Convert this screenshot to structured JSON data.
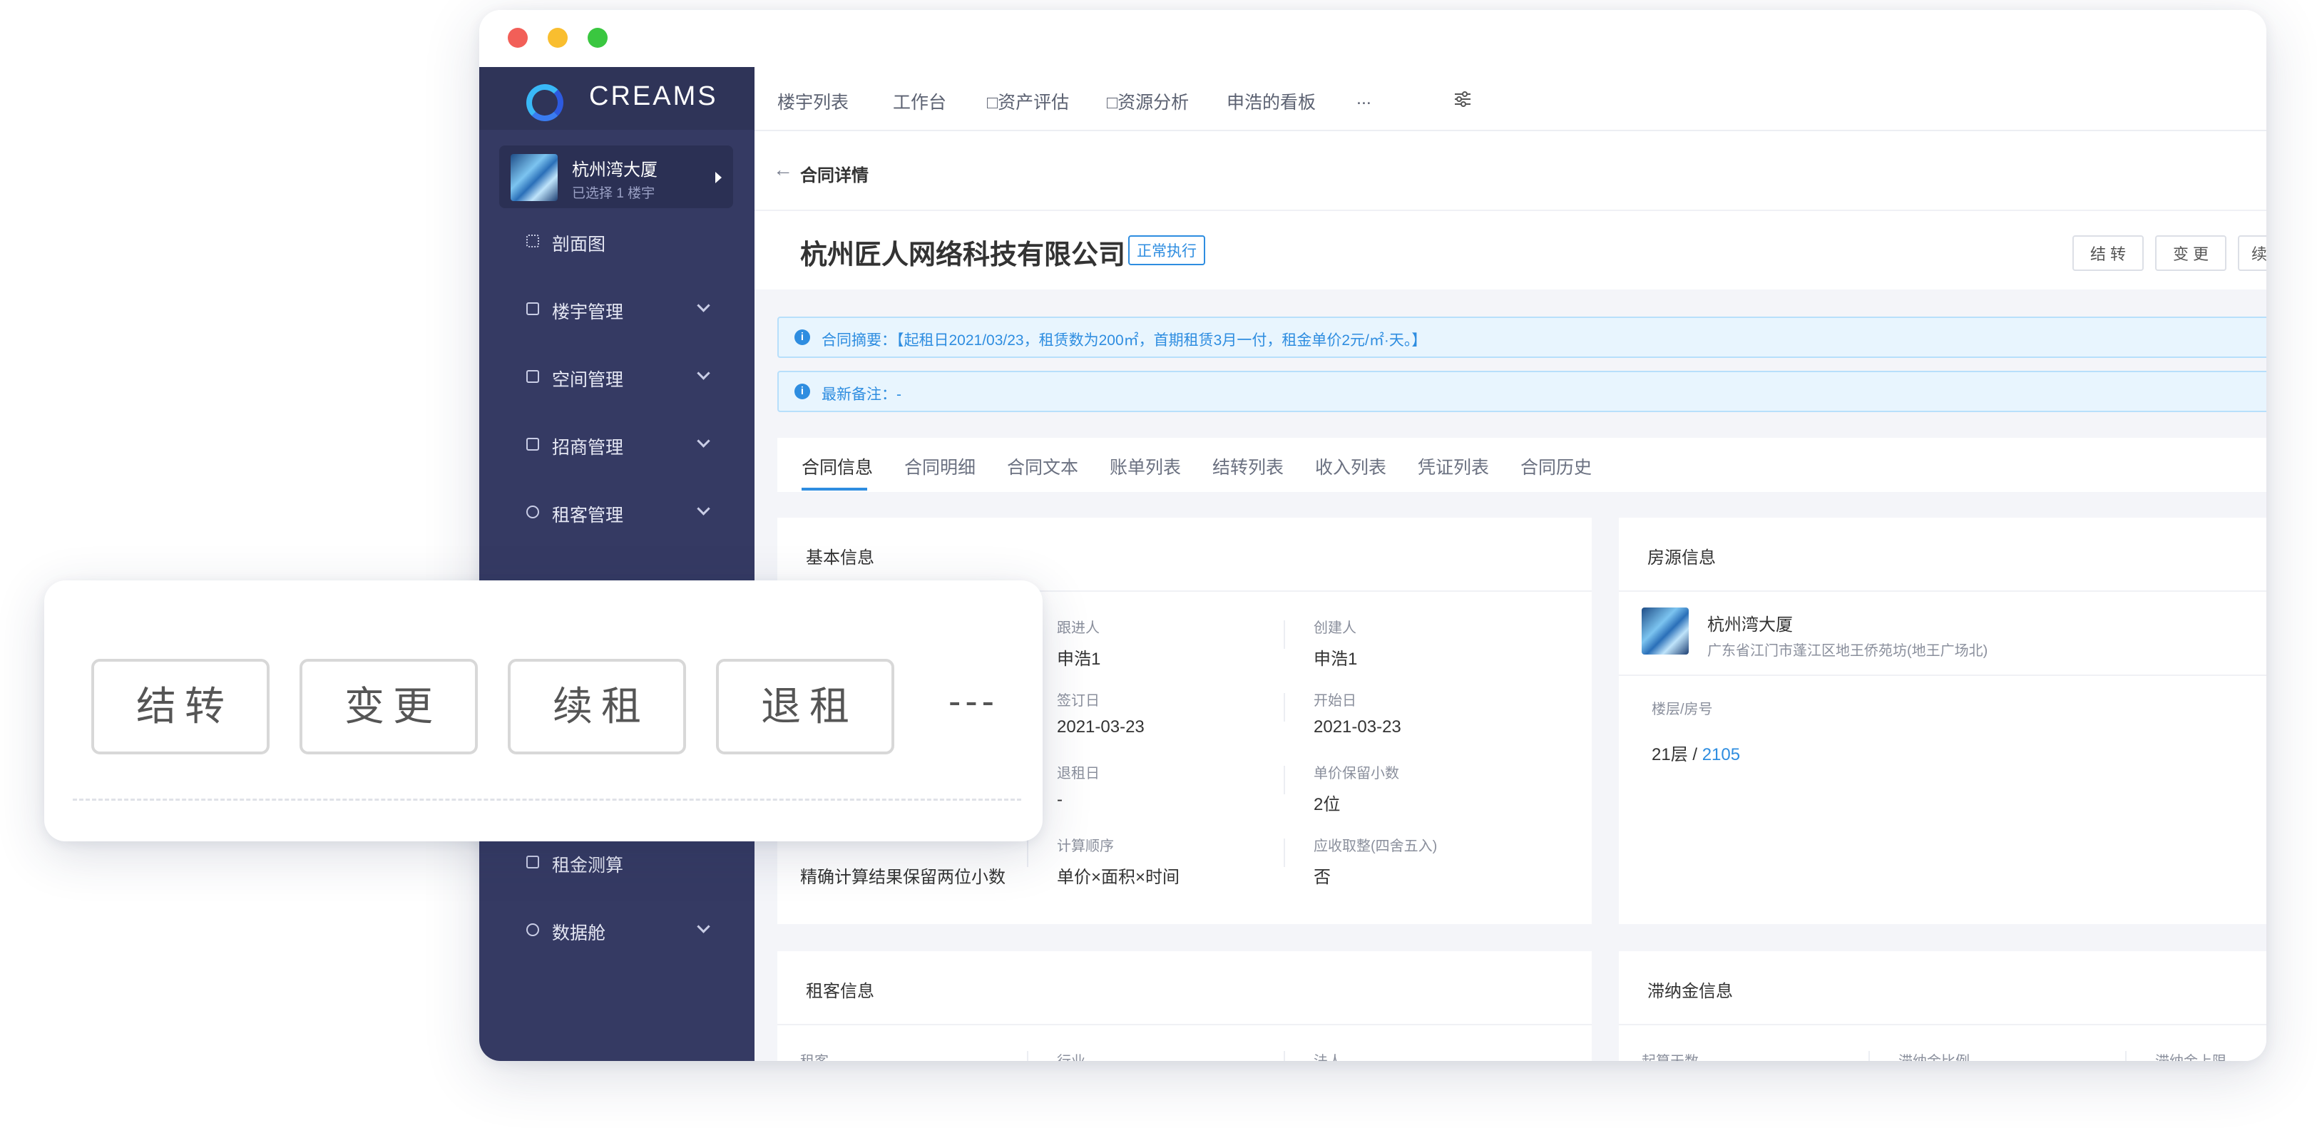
{
  "window": {
    "brand": "CREAMS",
    "project": {
      "name": "杭州湾大厦",
      "sub": "已选择 1 楼宇"
    },
    "sidebar": {
      "items": [
        {
          "label": "剖面图",
          "icon": "grid-icon",
          "chevron": false
        },
        {
          "label": "楼宇管理",
          "icon": "building-icon",
          "chevron": true
        },
        {
          "label": "空间管理",
          "icon": "layout-icon",
          "chevron": true
        },
        {
          "label": "招商管理",
          "icon": "enter-icon",
          "chevron": true
        },
        {
          "label": "租客管理",
          "icon": "user-icon",
          "chevron": true
        },
        {
          "label": "租金测算",
          "icon": "calculator-icon",
          "chevron": false
        },
        {
          "label": "数据舱",
          "icon": "dashboard-icon",
          "chevron": true
        }
      ]
    },
    "topnav": {
      "items": [
        "楼宇列表",
        "工作台",
        "□资产评估",
        "□资源分析",
        "申浩的看板",
        "..."
      ]
    },
    "breadcrumb": "合同详情",
    "company": "杭州匠人网络科技有限公司",
    "status": "正常执行",
    "actions": [
      "结 转",
      "变 更",
      "续"
    ],
    "alerts": [
      "合同摘要：【起租日2021/03/23，租赁数为200㎡，首期租赁3月一付，租金单价2元/㎡·天。】",
      "最新备注：-"
    ],
    "tabs": [
      "合同信息",
      "合同明细",
      "合同文本",
      "账单列表",
      "结转列表",
      "收入列表",
      "凭证列表",
      "合同历史"
    ],
    "basic_info": {
      "title": "基本信息",
      "fields": [
        {
          "label": "跟进人",
          "value": "申浩1"
        },
        {
          "label": "创建人",
          "value": "申浩1"
        },
        {
          "label": "签订日",
          "value": "2021-03-23"
        },
        {
          "label": "开始日",
          "value": "2021-03-23"
        },
        {
          "label": "退租日",
          "value": "-"
        },
        {
          "label": "单价保留小数",
          "value": "2位"
        },
        {
          "label": "计算顺序",
          "value": "单价×面积×时间"
        },
        {
          "label": "应收取整(四舍五入)",
          "value": "否"
        }
      ],
      "left_value": "精确计算结果保留两位小数"
    },
    "property_info": {
      "title": "房源信息",
      "name": "杭州湾大厦",
      "address": "广东省江门市蓬江区地王侨苑坊(地王广场北)",
      "floor_label": "楼层/房号",
      "floor_prefix": "21层 / ",
      "room": "2105"
    },
    "tenant_info": {
      "title": "租客信息",
      "labels": [
        "租客",
        "行业",
        "法人"
      ]
    },
    "late_fee_info": {
      "title": "滞纳金信息",
      "labels": [
        "起算天数",
        "滞纳金比例",
        "滞纳金上限"
      ]
    }
  },
  "float_panel": {
    "buttons": [
      "结转",
      "变更",
      "续租",
      "退租"
    ],
    "more": "---"
  }
}
